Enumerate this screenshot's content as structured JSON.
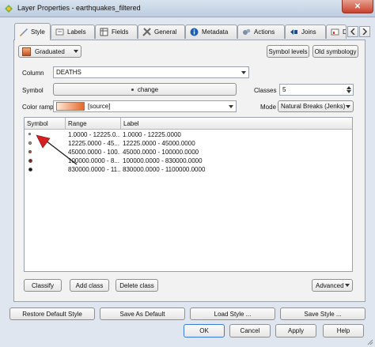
{
  "window": {
    "title": "Layer Properties - earthquakes_filtered",
    "close_glyph": "✕"
  },
  "tabs": [
    {
      "label": "Style",
      "icon": "brush-icon"
    },
    {
      "label": "Labels",
      "icon": "labels-icon"
    },
    {
      "label": "Fields",
      "icon": "fields-icon"
    },
    {
      "label": "General",
      "icon": "general-icon"
    },
    {
      "label": "Metadata",
      "icon": "info-icon"
    },
    {
      "label": "Actions",
      "icon": "gears-icon"
    },
    {
      "label": "Joins",
      "icon": "joins-icon"
    },
    {
      "label": "D",
      "icon": "diagram-icon"
    }
  ],
  "style": {
    "renderer": "Graduated",
    "symbol_levels_label": "Symbol levels",
    "old_symbology_label": "Old symbology",
    "column_label": "Column",
    "column_value": "DEATHS",
    "symbol_label": "Symbol",
    "symbol_change_label": "change",
    "classes_label": "Classes",
    "classes_value": "5",
    "color_ramp_label": "Color ramp",
    "color_ramp_value": "[source]",
    "mode_label": "Mode",
    "mode_value": "Natural Breaks (Jenks)"
  },
  "table": {
    "headers": [
      "Symbol",
      "Range",
      "Label"
    ],
    "rows": [
      {
        "range": "1.0000 - 12225.0...",
        "label": "1.0000 - 12225.0000",
        "color": "#f2dcc9",
        "size": 3
      },
      {
        "range": "12225.0000 - 45...",
        "label": "12225.0000 - 45000.0000",
        "color": "#e3a07a",
        "size": 4
      },
      {
        "range": "45000.0000 - 100...",
        "label": "45000.0000 - 100000.0000",
        "color": "#c2543a",
        "size": 4
      },
      {
        "range": "100000.0000 - 8...",
        "label": "100000.0000 - 830000.0000",
        "color": "#8c1c10",
        "size": 5
      },
      {
        "range": "830000.0000 - 11...",
        "label": "830000.0000 - 1100000.0000",
        "color": "#2a0604",
        "size": 5
      }
    ]
  },
  "buttons": {
    "classify": "Classify",
    "add_class": "Add class",
    "delete_class": "Delete class",
    "advanced": "Advanced",
    "restore_default": "Restore Default Style",
    "save_default": "Save As Default",
    "load_style": "Load Style ...",
    "save_style": "Save Style ...",
    "ok": "OK",
    "cancel": "Cancel",
    "apply": "Apply",
    "help": "Help"
  },
  "colors": {
    "arrow": "#d42020",
    "title_bar": "#c7d5e6",
    "ramp_start": "#fde9d9",
    "ramp_end": "#e4692a"
  }
}
